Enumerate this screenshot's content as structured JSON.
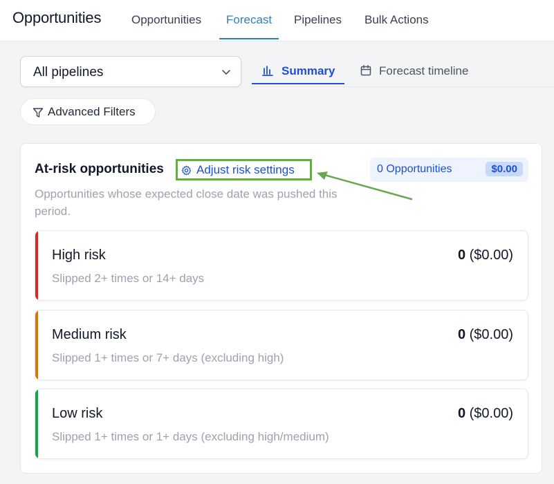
{
  "topnav": {
    "title": "Opportunities",
    "tabs": [
      {
        "label": "Opportunities",
        "active": false
      },
      {
        "label": "Forecast",
        "active": true
      },
      {
        "label": "Pipelines",
        "active": false
      },
      {
        "label": "Bulk Actions",
        "active": false
      }
    ]
  },
  "filters": {
    "pipeline_select": {
      "value": "All pipelines",
      "icon": "chevron-down-icon"
    },
    "view_tabs": [
      {
        "label": "Summary",
        "icon": "bar-chart-icon",
        "active": true
      },
      {
        "label": "Forecast timeline",
        "icon": "calendar-icon",
        "active": false
      }
    ],
    "advanced_filters": {
      "label": "Advanced Filters",
      "icon": "filter-icon"
    }
  },
  "at_risk": {
    "title": "At-risk opportunities",
    "settings_link": {
      "label": "Adjust risk settings",
      "icon": "gear-icon"
    },
    "subtitle": "Opportunities whose expected close date was pushed this period.",
    "summary": {
      "count_label": "0 Opportunities",
      "amount": "$0.00"
    },
    "levels": [
      {
        "name": "High risk",
        "description": "Slipped 2+ times or 14+ days",
        "count": "0",
        "amount": "($0.00)",
        "color": "#dc2626"
      },
      {
        "name": "Medium risk",
        "description": "Slipped 1+ times or 7+ days (excluding high)",
        "count": "0",
        "amount": "($0.00)",
        "color": "#d97706"
      },
      {
        "name": "Low risk",
        "description": "Slipped 1+ times or 1+ days (excluding high/medium)",
        "count": "0",
        "amount": "($0.00)",
        "color": "#16a34a"
      }
    ]
  },
  "colors": {
    "nav_active": "#2f80b5",
    "primary": "#1d4fd6",
    "highlight_box": "#6aa84f"
  }
}
